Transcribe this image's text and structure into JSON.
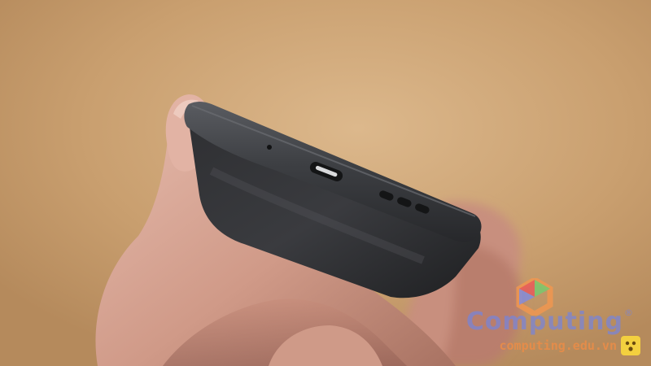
{
  "photo": {
    "subject": "smartphone-bottom-edge-held-in-hand",
    "colors": {
      "background": "#c9a070",
      "phone_body": "#2a2b2e",
      "phone_edge": "#45474b",
      "skin": "#d7a99a"
    }
  },
  "watermark": {
    "brand": "Computing",
    "registered_mark": "®",
    "url": "computing.edu.vn",
    "colors": {
      "brand": "#7a84d6",
      "url": "#eb8c46"
    }
  }
}
